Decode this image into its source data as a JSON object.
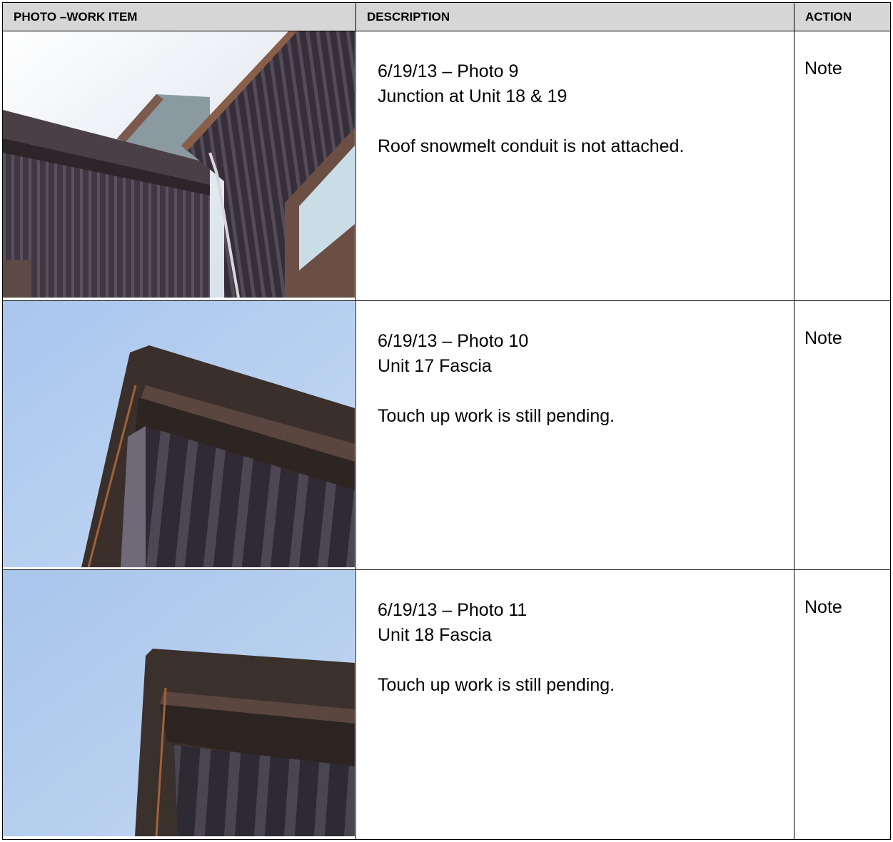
{
  "table": {
    "headers": {
      "photo": "PHOTO –WORK ITEM",
      "description": "DESCRIPTION",
      "action": "ACTION"
    },
    "rows": [
      {
        "photo_label": "6/19/13 – Photo 9",
        "location": "Junction at Unit 18 & 19",
        "note": "Roof snowmelt conduit is not attached.",
        "action": "Note"
      },
      {
        "photo_label": "6/19/13 – Photo 10",
        "location": "Unit 17 Fascia",
        "note": "Touch up work is still pending.",
        "action": "Note"
      },
      {
        "photo_label": "6/19/13 – Photo 11",
        "location": "Unit 18 Fascia",
        "note": "Touch up work is still pending.",
        "action": "Note"
      }
    ]
  },
  "colors": {
    "header_bg": "#d6d6d6",
    "siding": "#3c3540",
    "sky": "#b3cdef"
  }
}
